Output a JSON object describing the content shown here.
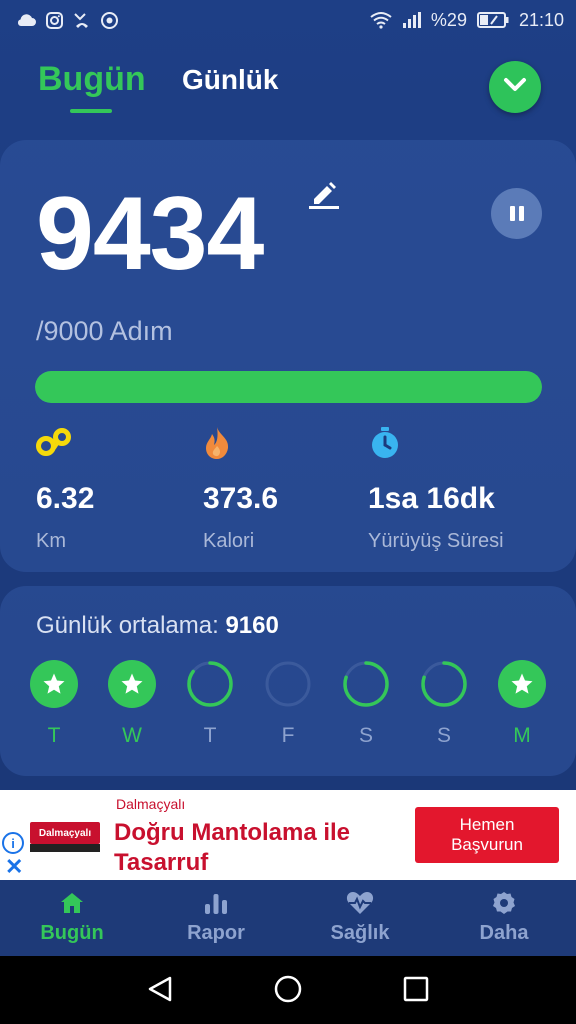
{
  "status_bar": {
    "left_icons": [
      "cloud-icon",
      "instagram-icon",
      "missed-call-icon",
      "chrome-icon"
    ],
    "right_icons": [
      "wifi-icon",
      "signal-icon",
      "battery-icon"
    ],
    "battery": "%29",
    "time": "21:10"
  },
  "header": {
    "tab_today": "Bugün",
    "tab_daily": "Günlük",
    "dropdown_icon": "chevron-down-icon"
  },
  "summary": {
    "steps": "9434",
    "goal": "/9000 Adım",
    "progress": 1.0,
    "stats": [
      {
        "icon": "distance-icon",
        "value": "6.32",
        "label": "Km"
      },
      {
        "icon": "flame-icon",
        "value": "373.6",
        "label": "Kalori"
      },
      {
        "icon": "stopwatch-icon",
        "value": "1sa 16dk",
        "label": "Yürüyüş Süresi"
      }
    ]
  },
  "weekly": {
    "avg_label": "Günlük ortalama:",
    "avg_value": "9160",
    "days": [
      {
        "letter": "T",
        "state": "complete",
        "progress": 1.0
      },
      {
        "letter": "W",
        "state": "complete",
        "progress": 1.0
      },
      {
        "letter": "T",
        "state": "partial",
        "progress": 0.85
      },
      {
        "letter": "F",
        "state": "empty",
        "progress": 0
      },
      {
        "letter": "S",
        "state": "partial",
        "progress": 0.8
      },
      {
        "letter": "S",
        "state": "partial",
        "progress": 0.8
      },
      {
        "letter": "M",
        "state": "complete",
        "progress": 1.0
      }
    ]
  },
  "ad": {
    "logo_text": "Dalmaçyalı",
    "brand": "Dalmaçyalı",
    "title": "Doğru Mantolama ile Tasarruf",
    "cta": "Hemen Başvurun",
    "info_icon": "info-icon",
    "close_icon": "close-icon"
  },
  "bottom_nav": [
    {
      "icon": "home-icon",
      "label": "Bugün",
      "active": true
    },
    {
      "icon": "bar-chart-icon",
      "label": "Rapor",
      "active": false
    },
    {
      "icon": "heart-pulse-icon",
      "label": "Sağlık",
      "active": false
    },
    {
      "icon": "gear-icon",
      "label": "Daha",
      "active": false
    }
  ],
  "colors": {
    "accent_green": "#34c759",
    "background": "#1e3f86",
    "muted_text": "#aab8d8",
    "inactive_nav": "#8ea3cf",
    "ad_red": "#e3172d"
  }
}
